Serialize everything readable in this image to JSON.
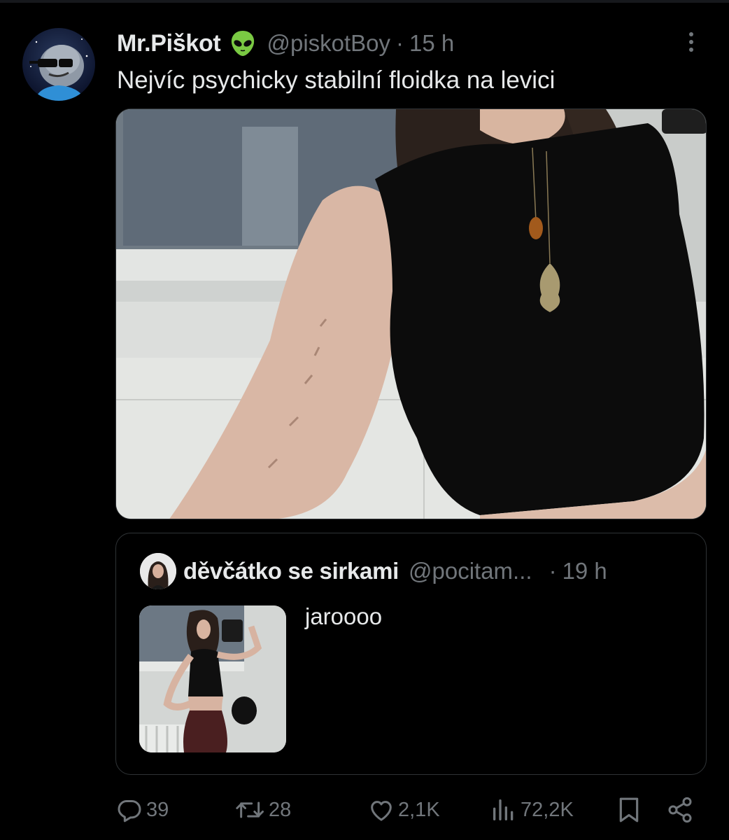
{
  "tweet": {
    "author_name": "Mr.Piškot",
    "author_badge_icon": "alien-emoji-icon",
    "handle": "@piskotBoy",
    "separator": "·",
    "time": "15 h",
    "text": "Nejvíc psychicky stabilní floidka na levici",
    "more_icon": "more-options-icon"
  },
  "quoted_tweet": {
    "author_name": "děvčátko se sirkami",
    "handle": "@pocitam...",
    "separator": "·",
    "time": "19 h",
    "text": "jaroooo"
  },
  "actions": {
    "reply_count": "39",
    "repost_count": "28",
    "like_count": "2,1K",
    "views_count": "72,2K",
    "icons": [
      "reply-icon",
      "repost-icon",
      "like-icon",
      "views-icon",
      "bookmark-icon",
      "share-icon"
    ]
  },
  "colors": {
    "background": "#000000",
    "text_primary": "#e7e9ea",
    "text_secondary": "#71767b",
    "border": "#2f3336",
    "alien_green": "#7ac943"
  }
}
